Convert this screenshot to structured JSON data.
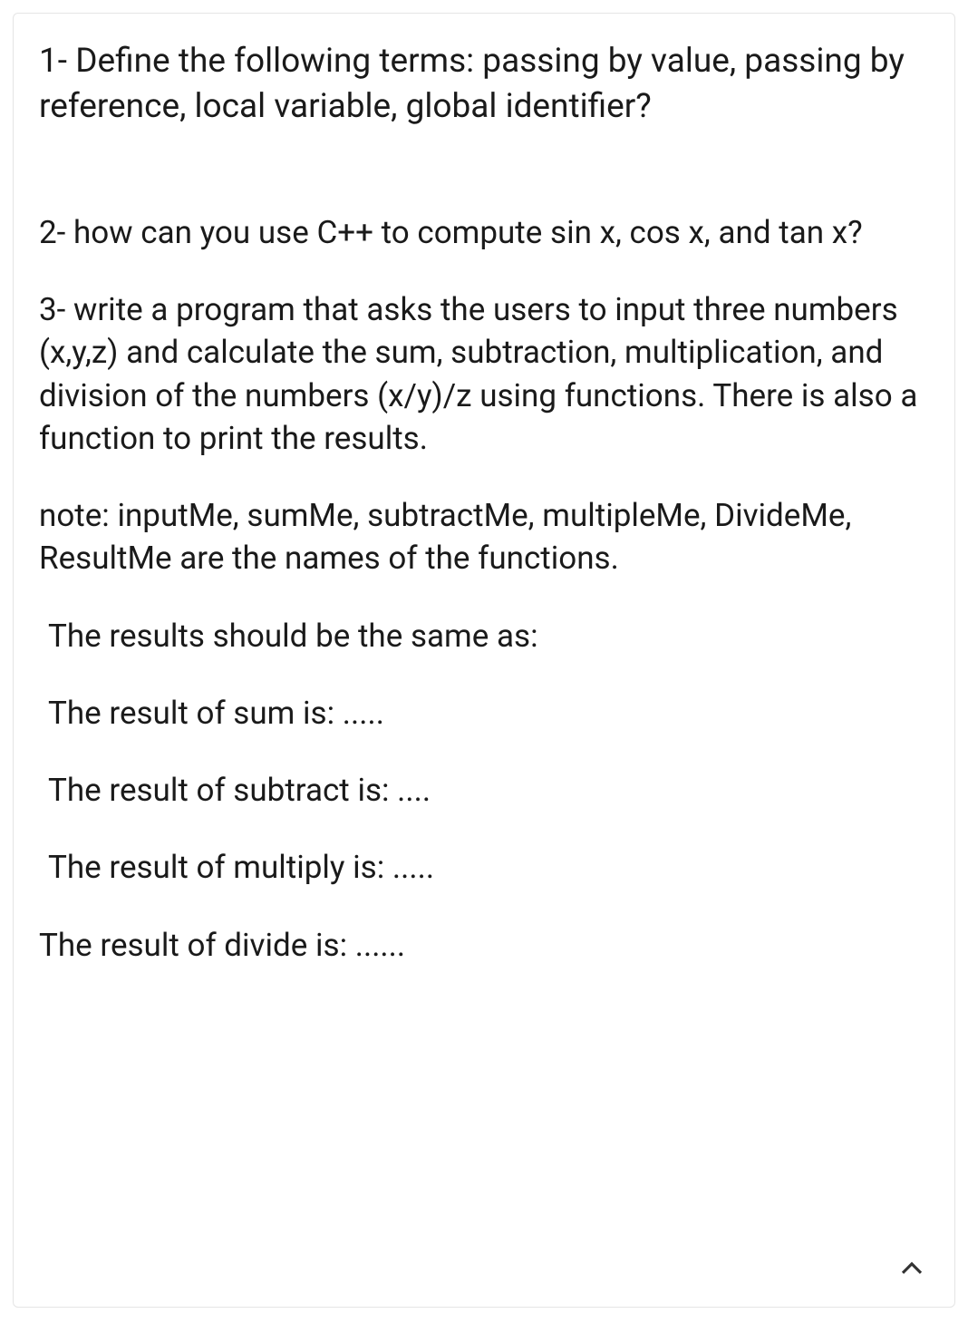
{
  "content": {
    "q1": "1- Define the following terms: passing by value, passing by reference, local variable, global identifier?",
    "q2": " 2- how can you use C++ to compute sin x, cos x, and tan x?",
    "q3": " 3- write a program that asks the users to input three numbers (x,y,z) and calculate the sum, subtraction, multiplication, and division of the numbers (x/y)/z using functions. There is also a function to print the results.",
    "note": " note: inputMe, sumMe, subtractMe, multipleMe, DivideMe, ResultMe are the names of the functions.",
    "results_intro": " The results should be the same as:",
    "result_sum": " The result of sum is: .....",
    "result_subtract": " The result of subtract is: ....",
    "result_multiply": " The result of multiply is: .....",
    "result_divide": "The result of divide is: ......"
  }
}
